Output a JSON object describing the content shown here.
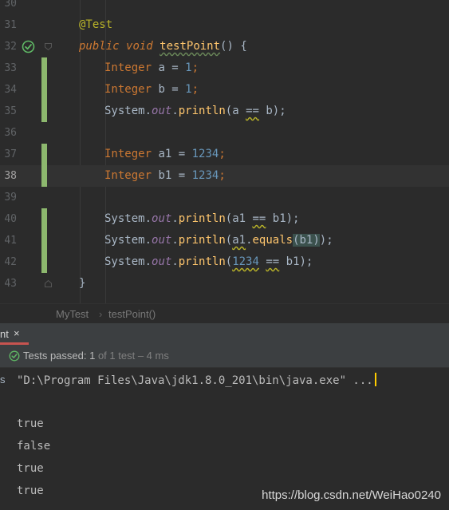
{
  "editor": {
    "lines": [
      {
        "number": "30"
      },
      {
        "number": "31",
        "tokens": [
          [
            "@Test",
            "annotation"
          ]
        ]
      },
      {
        "number": "32",
        "tokens": [
          [
            "public",
            "keyword"
          ],
          [
            " ",
            "plain"
          ],
          [
            "void",
            "keyword"
          ],
          [
            " ",
            "plain"
          ],
          [
            "testPoint",
            "method-decl"
          ],
          [
            "() ",
            "plain"
          ],
          [
            "{",
            "plain"
          ]
        ]
      },
      {
        "number": "33",
        "tokens": [
          [
            "Integer",
            "type"
          ],
          [
            " a = ",
            "plain"
          ],
          [
            "1",
            "num"
          ],
          [
            ";",
            "num-orange"
          ]
        ]
      },
      {
        "number": "34",
        "tokens": [
          [
            "Integer",
            "type"
          ],
          [
            " b = ",
            "plain"
          ],
          [
            "1",
            "num"
          ],
          [
            ";",
            "num-orange"
          ]
        ]
      },
      {
        "number": "35",
        "tokens": [
          [
            "System.",
            "plain"
          ],
          [
            "out",
            "field"
          ],
          [
            ".",
            "plain"
          ],
          [
            "println",
            "method"
          ],
          [
            "(a ",
            "plain"
          ],
          [
            "==",
            "warn"
          ],
          [
            " b);",
            "plain"
          ]
        ]
      },
      {
        "number": "36"
      },
      {
        "number": "37",
        "tokens": [
          [
            "Integer",
            "type"
          ],
          [
            " a1 = ",
            "plain"
          ],
          [
            "1234",
            "num"
          ],
          [
            ";",
            "num-orange"
          ]
        ]
      },
      {
        "number": "38",
        "tokens": [
          [
            "Integer",
            "type"
          ],
          [
            " b1 = ",
            "plain"
          ],
          [
            "1234",
            "num"
          ],
          [
            ";",
            "num-orange"
          ]
        ]
      },
      {
        "number": "39"
      },
      {
        "number": "40",
        "tokens": [
          [
            "System.",
            "plain"
          ],
          [
            "out",
            "field"
          ],
          [
            ".",
            "plain"
          ],
          [
            "println",
            "method"
          ],
          [
            "(a1 ",
            "plain"
          ],
          [
            "==",
            "warn"
          ],
          [
            " b1);",
            "plain"
          ]
        ]
      },
      {
        "number": "41",
        "tokens": [
          [
            "System.",
            "plain"
          ],
          [
            "out",
            "field"
          ],
          [
            ".",
            "plain"
          ],
          [
            "println",
            "method"
          ],
          [
            "(",
            "plain"
          ],
          [
            "a1",
            "warn"
          ],
          [
            ".",
            "plain"
          ],
          [
            "equals",
            "method"
          ],
          [
            "(b1)",
            "paren-match"
          ],
          [
            ");",
            "plain"
          ]
        ]
      },
      {
        "number": "42",
        "tokens": [
          [
            "System.",
            "plain"
          ],
          [
            "out",
            "field"
          ],
          [
            ".",
            "plain"
          ],
          [
            "println",
            "method"
          ],
          [
            "(",
            "plain"
          ],
          [
            "1234",
            "num-warn"
          ],
          [
            " ",
            "plain"
          ],
          [
            "==",
            "warn"
          ],
          [
            " b1);",
            "plain"
          ]
        ]
      },
      {
        "number": "43",
        "tokens": [
          [
            "}",
            "plain"
          ]
        ]
      }
    ]
  },
  "breadcrumb": {
    "class_name": "MyTest",
    "separator": "›",
    "method_name": "testPoint()"
  },
  "run_panel": {
    "tab_label": "nt",
    "tab_close": "×",
    "status": {
      "passed_label": "Tests passed: ",
      "passed_count": "1",
      "of_text": " of 1 test – 4 ms"
    },
    "console_side_label": "s",
    "command_line": "\"D:\\Program Files\\Java\\jdk1.8.0_201\\bin\\java.exe\" ...",
    "output_lines": [
      "true",
      "false",
      "true",
      "true"
    ]
  },
  "watermark": "https://blog.csdn.net/WeiHao0240",
  "colors": {
    "background": "#2b2b2b",
    "gutter_change_bar": "#8db86e",
    "run_icon": "#5fb865",
    "tab_underline": "#c75450",
    "caret": "#ffcc00"
  },
  "icons": {
    "run_gutter": "run-test-passed-icon",
    "fold": "fold-icon",
    "status": "check-circle-icon"
  }
}
